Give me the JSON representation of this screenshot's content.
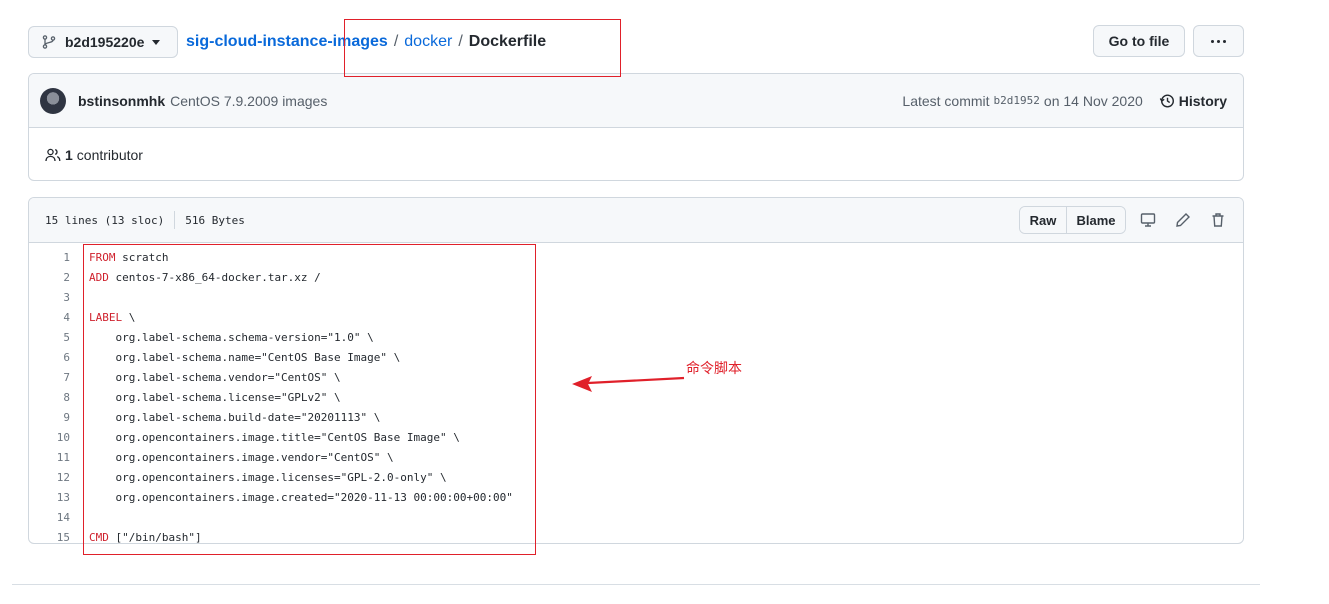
{
  "top_bar": {
    "branch": "b2d195220e",
    "breadcrumb": {
      "repo": "sig-cloud-instance-images",
      "separator": "/",
      "dir": "docker",
      "file": "Dockerfile"
    },
    "go_to_file": "Go to file",
    "more_icon": "kebab-horizontal-icon"
  },
  "commit": {
    "author": "bstinsonmhk",
    "message": "CentOS 7.9.2009 images",
    "latest_label": "Latest commit",
    "hash": "b2d1952",
    "date": "on 14 Nov 2020",
    "history": "History"
  },
  "contributors": {
    "count": "1",
    "label": "contributor"
  },
  "file": {
    "lines_info": "15 lines (13 sloc)",
    "size": "516 Bytes",
    "raw": "Raw",
    "blame": "Blame",
    "icons": [
      "desktop-icon",
      "pencil-icon",
      "trash-icon"
    ]
  },
  "code_lines": [
    {
      "n": "1",
      "kw": "FROM",
      "rest": " scratch"
    },
    {
      "n": "2",
      "kw": "ADD",
      "rest": " centos-7-x86_64-docker.tar.xz /"
    },
    {
      "n": "3",
      "kw": "",
      "rest": ""
    },
    {
      "n": "4",
      "kw": "LABEL",
      "rest": " \\"
    },
    {
      "n": "5",
      "kw": "",
      "rest": "    org.label-schema.schema-version=\"1.0\" \\"
    },
    {
      "n": "6",
      "kw": "",
      "rest": "    org.label-schema.name=\"CentOS Base Image\" \\"
    },
    {
      "n": "7",
      "kw": "",
      "rest": "    org.label-schema.vendor=\"CentOS\" \\"
    },
    {
      "n": "8",
      "kw": "",
      "rest": "    org.label-schema.license=\"GPLv2\" \\"
    },
    {
      "n": "9",
      "kw": "",
      "rest": "    org.label-schema.build-date=\"20201113\" \\"
    },
    {
      "n": "10",
      "kw": "",
      "rest": "    org.opencontainers.image.title=\"CentOS Base Image\" \\"
    },
    {
      "n": "11",
      "kw": "",
      "rest": "    org.opencontainers.image.vendor=\"CentOS\" \\"
    },
    {
      "n": "12",
      "kw": "",
      "rest": "    org.opencontainers.image.licenses=\"GPL-2.0-only\" \\"
    },
    {
      "n": "13",
      "kw": "",
      "rest": "    org.opencontainers.image.created=\"2020-11-13 00:00:00+00:00\""
    },
    {
      "n": "14",
      "kw": "",
      "rest": ""
    },
    {
      "n": "15",
      "kw": "CMD",
      "rest": " [\"/bin/bash\"]"
    }
  ],
  "annotation": {
    "label": "命令脚本",
    "color": "#e0202a"
  },
  "colors": {
    "link": "#0969da",
    "keyword": "#cf222e",
    "border": "#d0d7de",
    "header_bg": "#f6f8fa"
  }
}
